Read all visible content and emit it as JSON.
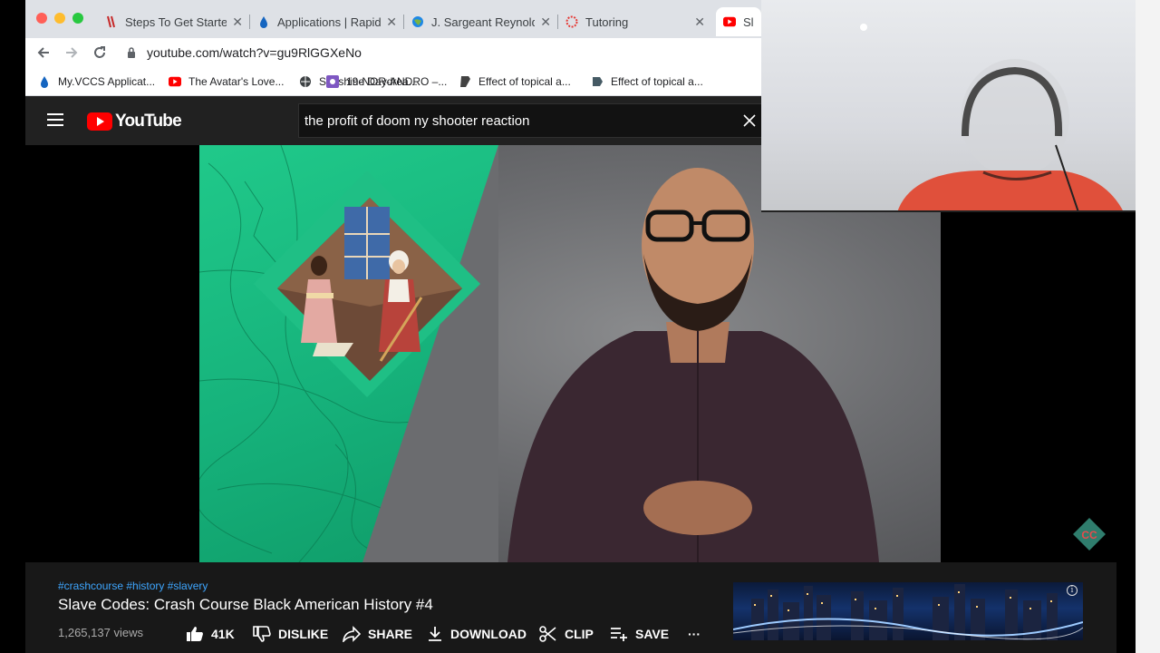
{
  "browser": {
    "tabs": [
      {
        "title": "Steps To Get Started",
        "icon": "vccs-icon"
      },
      {
        "title": "Applications | Rapid",
        "icon": "drop-icon"
      },
      {
        "title": "J. Sargeant Reynolds",
        "icon": "globe-icon"
      },
      {
        "title": "Tutoring",
        "icon": "ring-icon"
      },
      {
        "title": "Sla",
        "icon": "youtube-icon"
      }
    ],
    "tab_close": "✕",
    "url": "youtube.com/watch?v=gu9RlGGXeNo",
    "bookmarks": [
      {
        "label": "My.VCCS Applicat...",
        "icon": "drop-icon"
      },
      {
        "label": "The Avatar's Love...",
        "icon": "youtube-icon"
      },
      {
        "label": "Sunshine Daydrea...",
        "icon": "globe-icon"
      },
      {
        "label": "19-NOR-ANDRO –...",
        "icon": "app-icon"
      },
      {
        "label": "Effect of topical a...",
        "icon": "scribd-icon"
      }
    ]
  },
  "youtube": {
    "logo_text": "YouTube",
    "search_query": "the profit of doom ny shooter reaction"
  },
  "video": {
    "tags": "#crashcourse #history #slavery",
    "title": "Slave Codes: Crash Course Black American History #4",
    "views": "1,265,137 views",
    "actions": {
      "likes": "41K",
      "dislike": "DISLIKE",
      "share": "SHARE",
      "download": "DOWNLOAD",
      "clip": "CLIP",
      "save": "SAVE",
      "more": "···"
    },
    "badge": "CC"
  },
  "colors": {
    "youtube_red": "#ff0000",
    "link_blue": "#3ea6ff",
    "map_green": "#16b27b"
  }
}
